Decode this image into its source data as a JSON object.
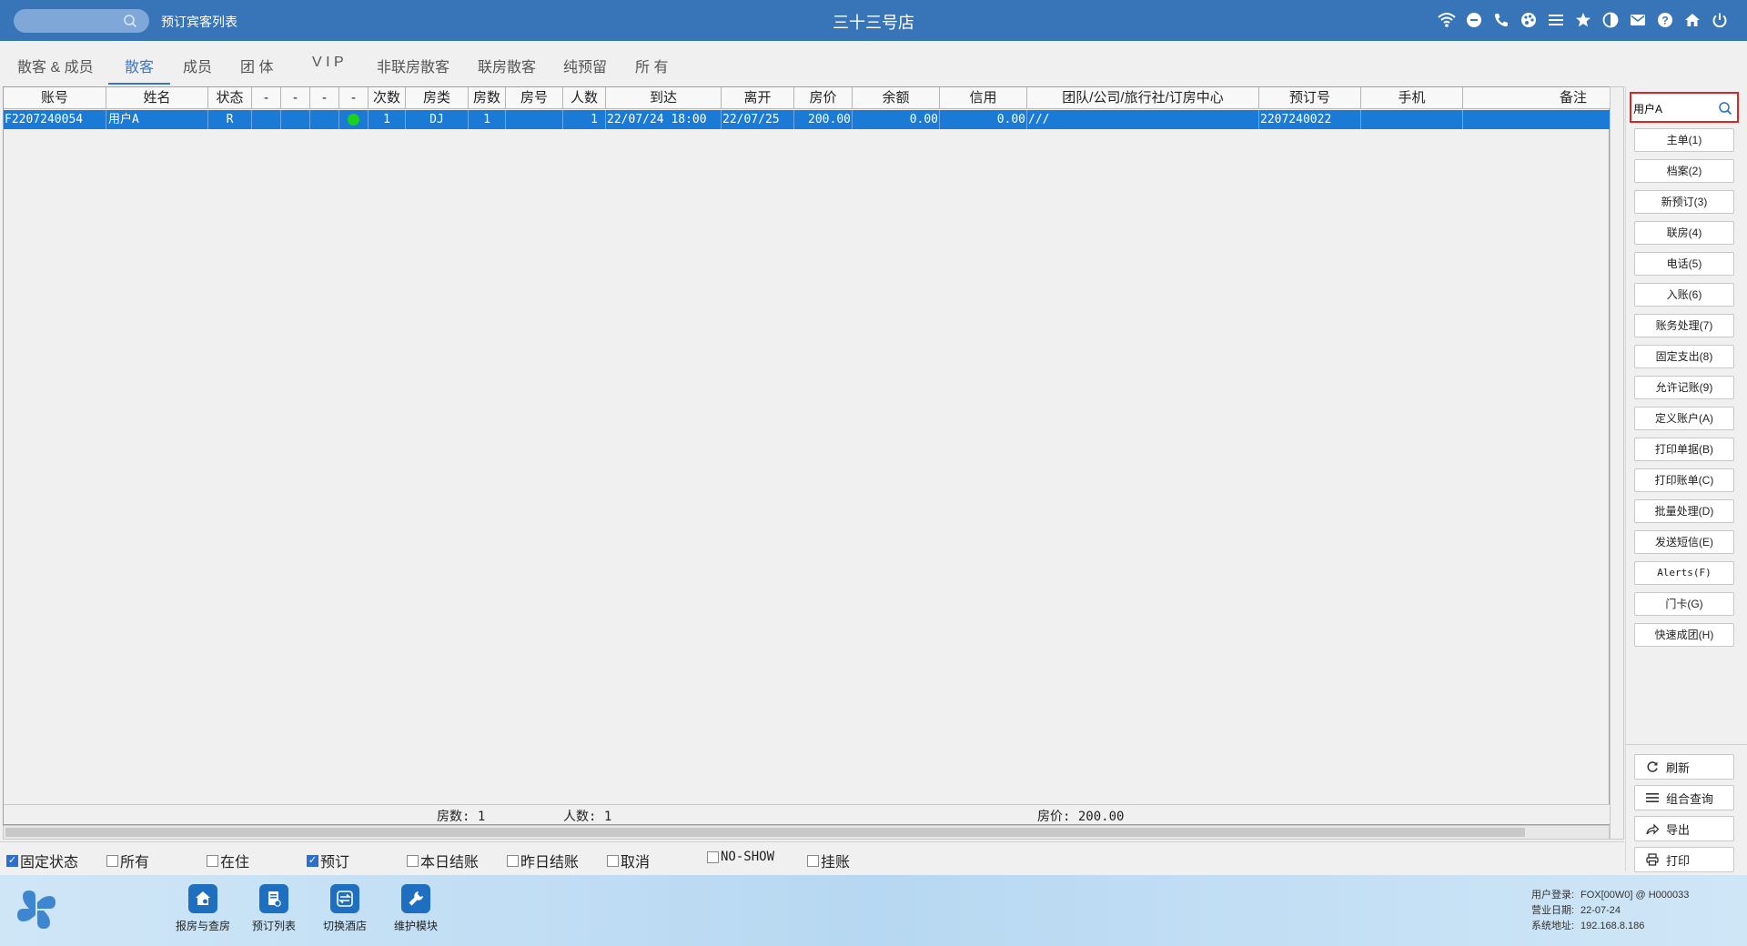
{
  "titlebar": {
    "breadcrumb": "预订宾客列表",
    "store_name": "三十三号店"
  },
  "tabs": [
    "散客 & 成员",
    "散客",
    "成员",
    "团 体",
    "V I P",
    "非联房散客",
    "联房散客",
    "纯预留",
    "所 有"
  ],
  "active_tab": "散客",
  "grid": {
    "columns": [
      "账号",
      "姓名",
      "状态",
      "-",
      "-",
      "-",
      "-",
      "次数",
      "房类",
      "房数",
      "房号",
      "人数",
      "到达",
      "离开",
      "房价",
      "余额",
      "信用",
      "团队/公司/旅行社/订房中心",
      "预订号",
      "手机",
      "备注"
    ],
    "row": {
      "account": "F2207240054",
      "name": "用户A",
      "status": "R",
      "count": "1",
      "room_type": "DJ",
      "rooms": "1",
      "room_no": "",
      "persons": "1",
      "arrival": "22/07/24 18:00",
      "departure": "22/07/25",
      "rate": "200.00",
      "balance": "0.00",
      "credit": "0.00",
      "group": "///",
      "booking_no": "2207240022",
      "mobile": "",
      "remark": ""
    },
    "totals": {
      "rooms": "房数: 1",
      "persons": "人数: 1",
      "rate": "房价: 200.00"
    }
  },
  "filters": [
    {
      "label": "固定状态",
      "checked": true
    },
    {
      "label": "所有",
      "checked": false
    },
    {
      "label": "在住",
      "checked": false
    },
    {
      "label": "预订",
      "checked": true
    },
    {
      "label": "本日结账",
      "checked": false
    },
    {
      "label": "昨日结账",
      "checked": false
    },
    {
      "label": "取消",
      "checked": false
    },
    {
      "label": "NO-SHOW",
      "checked": false
    },
    {
      "label": "挂账",
      "checked": false
    }
  ],
  "side_panel": {
    "search_value": "用户A",
    "actions": [
      "主单(1)",
      "档案(2)",
      "新预订(3)",
      "联房(4)",
      "电话(5)",
      "入账(6)",
      "账务处理(7)",
      "固定支出(8)",
      "允许记账(9)",
      "定义账户(A)",
      "打印单据(B)",
      "打印账单(C)",
      "批量处理(D)",
      "发送短信(E)",
      "Alerts(F)",
      "门卡(G)",
      "快速成团(H)"
    ],
    "bottom_actions": {
      "refresh": "刷新",
      "combo_query": "组合查询",
      "export": "导出",
      "print": "打印"
    }
  },
  "bottombar": {
    "apps": [
      "报房与查房",
      "预订列表",
      "切换酒店",
      "维护模块"
    ],
    "info": {
      "user_key": "用户登录:",
      "user_val": "FOX[00W0] @ H000033",
      "date_key": "营业日期:",
      "date_val": "22-07-24",
      "addr_key": "系统地址:",
      "addr_val": "192.168.8.186"
    }
  }
}
